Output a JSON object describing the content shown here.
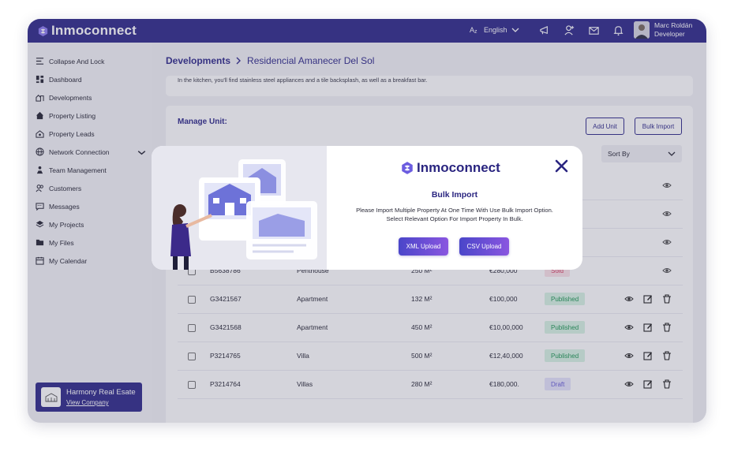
{
  "app": {
    "brand": "Inmoconnect"
  },
  "header": {
    "language": "English",
    "user_name": "Marc Roldán",
    "user_role": "Developer"
  },
  "sidebar": {
    "items": [
      {
        "label": "Collapse And Lock",
        "icon": "collapse-icon"
      },
      {
        "label": "Dashboard",
        "icon": "dashboard-icon"
      },
      {
        "label": "Developments",
        "icon": "developments-icon"
      },
      {
        "label": "Property Listing",
        "icon": "home-icon"
      },
      {
        "label": "Property Leads",
        "icon": "leads-icon"
      },
      {
        "label": "Network Connection",
        "icon": "globe-icon"
      },
      {
        "label": "Team Management",
        "icon": "team-icon"
      },
      {
        "label": "Customers",
        "icon": "customers-icon"
      },
      {
        "label": "Messages",
        "icon": "message-icon"
      },
      {
        "label": "My Projects",
        "icon": "layers-icon"
      },
      {
        "label": "My Files",
        "icon": "folder-icon"
      },
      {
        "label": "My Calendar",
        "icon": "calendar-icon"
      }
    ],
    "company": {
      "name": "Harmony Real Esate",
      "link": "View Company"
    }
  },
  "breadcrumb": {
    "parent": "Developments",
    "current": "Residencial Amanecer Del Sol"
  },
  "description": "In the kitchen, you'll find stainless steel appliances and a tile backsplash, as well as a breakfast bar.",
  "manage": {
    "title": "Manage Unit:",
    "add_unit": "Add Unit",
    "bulk_import": "Bulk Import",
    "sort_by": "Sort By"
  },
  "units": [
    {
      "id": "B5638786",
      "type": "Penthouse",
      "area": "250 M²",
      "price": "€280,000",
      "status": "Sold"
    },
    {
      "id": "G3421567",
      "type": "Apartment",
      "area": "132 M²",
      "price": "€100,000",
      "status": "Published"
    },
    {
      "id": "G3421568",
      "type": "Apartment",
      "area": "450 M²",
      "price": "€10,00,000",
      "status": "Published"
    },
    {
      "id": "P3214765",
      "type": "Villa",
      "area": "500 M²",
      "price": "€12,40,000",
      "status": "Published"
    },
    {
      "id": "P3214764",
      "type": "Villas",
      "area": "280 M²",
      "price": "€180,000.",
      "status": "Draft"
    }
  ],
  "modal": {
    "brand": "Inmoconnect",
    "title": "Bulk Import",
    "text_line1": "Please Import Multiple Property At One Time With Use Bulk Import Option.",
    "text_line2": "Select Relevant Option For Import Property In Bulk.",
    "xml_button": "XML Upload",
    "csv_button": "CSV Upload"
  },
  "colors": {
    "primary": "#35308e",
    "sold": "#d9466a",
    "published": "#249a59",
    "draft": "#6c62d9"
  }
}
